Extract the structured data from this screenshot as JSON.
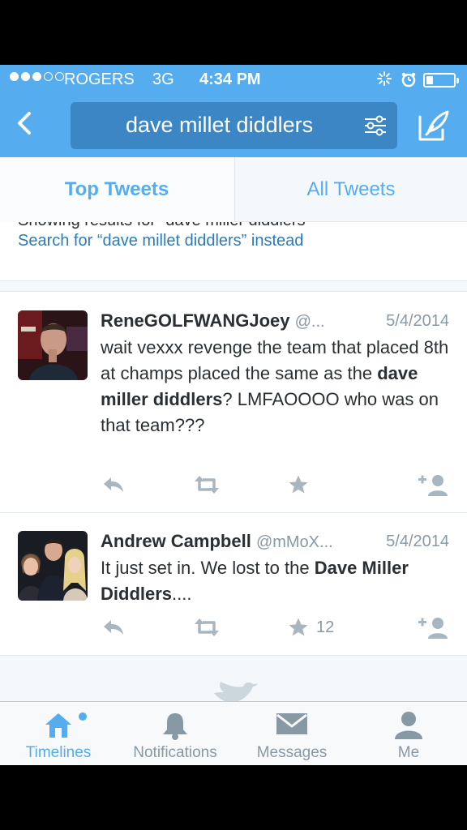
{
  "status_bar": {
    "carrier": "ROGERS",
    "network": "3G",
    "time": "4:34 PM",
    "signal_bars_filled": 3,
    "signal_bars_total": 5
  },
  "nav": {
    "search_query": "dave millet diddlers",
    "back_icon": "chevron-left-icon",
    "filter_icon": "filter-sliders-icon",
    "compose_icon": "compose-quill-icon"
  },
  "tabs": [
    {
      "label": "Top Tweets",
      "active": true
    },
    {
      "label": "All Tweets",
      "active": false
    }
  ],
  "suggestion": {
    "cutoff_text": "Showing results for “dave miller diddlers”",
    "search_instead": "Search for “dave millet diddlers” instead"
  },
  "tweets": [
    {
      "name": "ReneGOLFWANGJoey",
      "handle": "@...",
      "date": "5/4/2014",
      "text_parts": [
        "wait vexxx revenge the team that placed 8th at champs placed the same as the ",
        "dave miller diddlers",
        "? LMFAOOOO who was on that team???"
      ],
      "favorites": ""
    },
    {
      "name": "Andrew Campbell",
      "handle": "@mMoX...",
      "date": "5/4/2014",
      "text_parts": [
        "It just set in. We lost to the ",
        "Dave Miller Diddlers",
        "...."
      ],
      "favorites": "12"
    }
  ],
  "tab_bar": [
    {
      "label": "Timelines",
      "icon": "home-icon",
      "active": true
    },
    {
      "label": "Notifications",
      "icon": "bell-icon",
      "active": false
    },
    {
      "label": "Messages",
      "icon": "envelope-icon",
      "active": false
    },
    {
      "label": "Me",
      "icon": "person-icon",
      "active": false
    }
  ],
  "colors": {
    "brand_blue": "#55acee",
    "link_blue": "#2b7bb9",
    "text": "#292f33",
    "muted": "#8899a6"
  }
}
